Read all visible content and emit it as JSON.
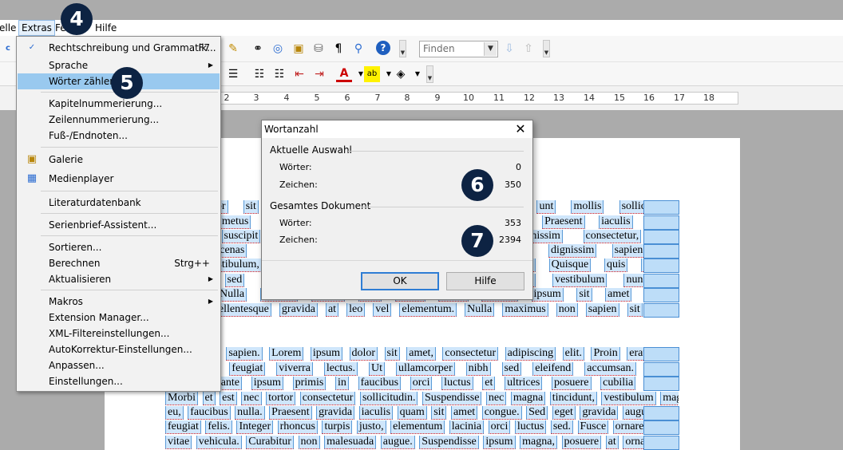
{
  "menubar": {
    "items": [
      {
        "label": "elle"
      },
      {
        "label": "Extras"
      },
      {
        "label": "Fe"
      },
      {
        "label": "Hilfe"
      }
    ]
  },
  "toolbar": {
    "find_placeholder": "Finden"
  },
  "ruler": {
    "numbers": [
      "2",
      "3",
      "4",
      "5",
      "6",
      "7",
      "8",
      "9",
      "10",
      "11",
      "12",
      "13",
      "14",
      "15",
      "16",
      "17",
      "18"
    ]
  },
  "extras_menu": {
    "items": [
      {
        "label": "Rechtschreibung und Grammatik...",
        "shortcut": "F7",
        "icon": "spellcheck-icon"
      },
      {
        "label": "Sprache",
        "submenu": true
      },
      {
        "label": "Wörter zählen",
        "highlighted": true
      },
      {
        "label": "Kapitelnummerierung..."
      },
      {
        "label": "Zeilennummerierung..."
      },
      {
        "label": "Fuß-/Endnoten..."
      },
      {
        "label": "Galerie",
        "icon": "gallery-icon"
      },
      {
        "label": "Medienplayer",
        "icon": "media-player-icon"
      },
      {
        "label": "Literaturdatenbank"
      },
      {
        "label": "Serienbrief-Assistent..."
      },
      {
        "label": "Sortieren..."
      },
      {
        "label": "Berechnen",
        "shortcut": "Strg++"
      },
      {
        "label": "Aktualisieren",
        "submenu": true
      },
      {
        "label": "Makros",
        "submenu": true
      },
      {
        "label": "Extension Manager..."
      },
      {
        "label": "XML-Filtereinstellungen..."
      },
      {
        "label": "AutoKorrektur-Einstellungen..."
      },
      {
        "label": "Anpassen..."
      },
      {
        "label": "Einstellungen..."
      }
    ]
  },
  "dialog": {
    "title": "Wortanzahl",
    "current_section": "Aktuelle Auswahl",
    "current_words_label": "Wörter:",
    "current_words": "0",
    "current_chars_label": "Zeichen:",
    "current_chars": "350",
    "total_section": "Gesamtes Dokument",
    "total_words_label": "Wörter:",
    "total_words": "353",
    "total_chars_label": "Zeichen:",
    "total_chars": "2394",
    "ok_label": "OK",
    "help_label": "Hilfe"
  },
  "badges": [
    "4",
    "5",
    "6",
    "7"
  ],
  "document": {
    "para1": [
      "um dolor sit amet, consectetur adipiscing elit. Proin unt mollis sollicitudin.",
      "onvallis metus tempor felis tempor, quis finibus ipsum. Praesent iaculis ligula",
      "liquam suscipit malesuada arcu. Suspendisse in dignissim consectetur, sit",
      "lit. Maecenas eget nisi eu tortor rutrum fringilla in dignissim sapien, ut",
      "agna vestibulum, a molestie leo fringilla. Nam sed mi. Quisque quis blandit",
      "faucibus sed volutpat est. Vivamus ultrices, pellentesque vestibulum nunc a",
      "acilisis. Nulla facilisi. Donec quis turpis diam. Integer ipsum sit amet massa",
      "ucibus. Pellentesque gravida at leo vel elementum. Nulla maximus non sapien sit amet"
    ],
    "para2": [
      "e ultrices sapien. Lorem ipsum dolor sit amet, consectetur adipiscing elit. Proin erat dui,",
      "nulla ac feugiat viverra lectus. Ut ullamcorper nibh sed eleifend accumsan. Nulla",
      "stibulum ante ipsum primis in faucibus orci luctus et ultrices posuere cubilia curae;",
      "Morbi et est nec tortor consectetur sollicitudin. Suspendisse nec magna tincidunt, vestibulum magna",
      "eu, faucibus nulla. Praesent gravida iaculis quam sit amet congue. Sed eget gravida augue, sed",
      "feugiat felis. Integer rhoncus turpis justo, elementum lacinia orci luctus sed. Fusce ornare sed lectus",
      "vitae vehicula. Curabitur non malesuada augue. Suspendisse ipsum magna, posuere at ornare ut,"
    ]
  }
}
